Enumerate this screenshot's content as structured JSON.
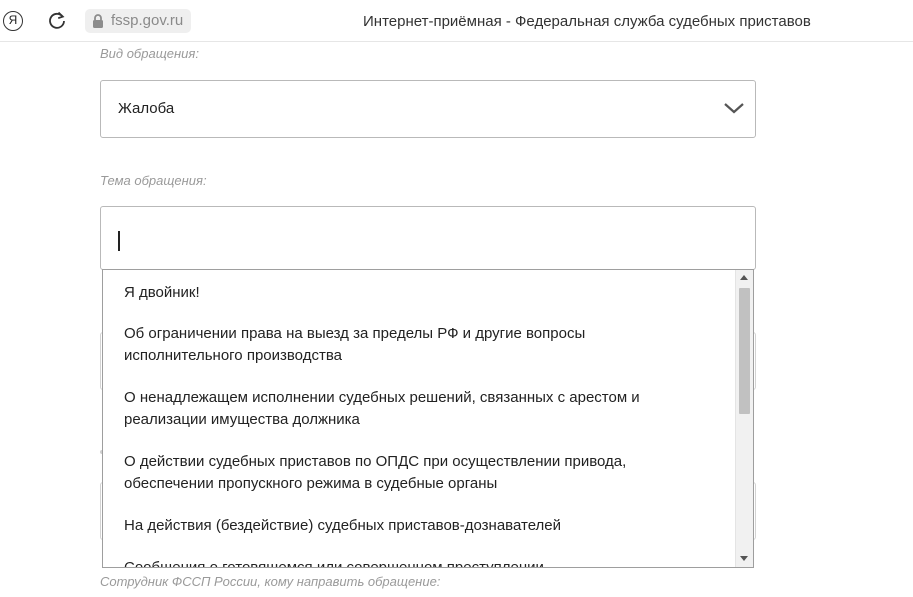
{
  "browser": {
    "yandex_glyph": "Я",
    "address": "fssp.gov.ru",
    "tab_title": "Интернет-приёмная - Федеральная служба судебных приставов"
  },
  "form": {
    "type_label": "Вид обращения:",
    "type_value": "Жалоба",
    "topic_label": "Тема обращения:",
    "topic_value": "",
    "employee_label": "Сотрудник ФССП России, кому направить обращение:"
  },
  "dropdown": {
    "options": [
      {
        "line1": "Я двойник!",
        "line2": ""
      },
      {
        "line1": "Об ограничении права на выезд за пределы РФ и другие вопросы",
        "line2": "исполнительного производства"
      },
      {
        "line1": "О ненадлежащем исполнении судебных решений, связанных с арестом и",
        "line2": "реализации имущества должника"
      },
      {
        "line1": "О действии судебных приставов по ОПДС при осуществлении привода,",
        "line2": "обеспечении пропускного режима в судебные органы"
      },
      {
        "line1": "На действия (бездействие) судебных приставов-дознавателей",
        "line2": ""
      },
      {
        "line1": "Сообщения о готовящемся или совершенном преступлении",
        "line2": ""
      }
    ]
  },
  "icons": {
    "yandex": "yandex-icon",
    "reload": "reload-icon",
    "lock": "lock-icon",
    "chevron": "chevron-down-icon",
    "scroll_up": "scroll-up-icon",
    "scroll_down": "scroll-down-icon"
  }
}
